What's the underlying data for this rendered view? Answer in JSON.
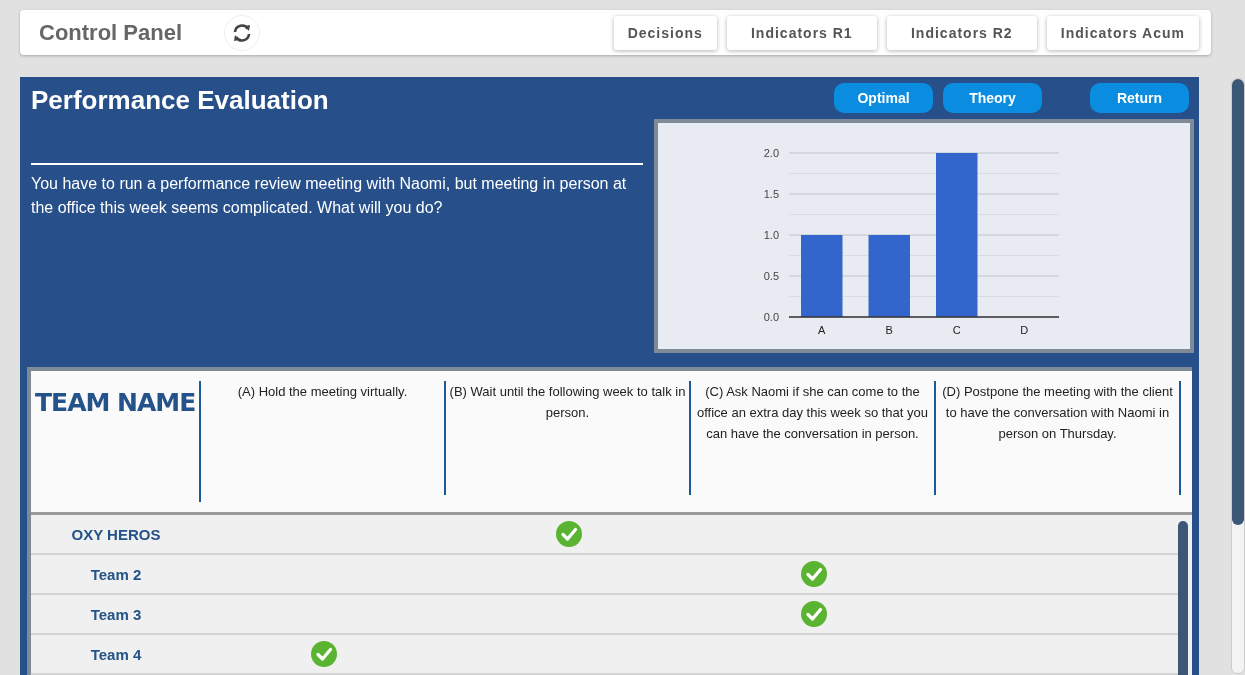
{
  "header": {
    "title": "Control Panel",
    "nav": [
      {
        "label": "Decisions"
      },
      {
        "label": "Indicators R1"
      },
      {
        "label": "Indicators R2"
      },
      {
        "label": "Indicators Acum"
      }
    ]
  },
  "panel": {
    "title": "Performance Evaluation",
    "buttons": [
      "Optimal",
      "Theory",
      "Return"
    ],
    "question": "You have to run a performance review meeting with Naomi, but meeting in person at the office this week seems complicated. What will you do?",
    "chart_data": {
      "type": "bar",
      "categories": [
        "A",
        "B",
        "C",
        "D"
      ],
      "values": [
        1,
        1,
        2,
        0
      ],
      "ylim": [
        0,
        2
      ],
      "grid": true,
      "yticks": [
        {
          "value": 0,
          "label": "0.0"
        },
        {
          "value": 0.5,
          "label": "0.5"
        },
        {
          "value": 1,
          "label": "1.0"
        },
        {
          "value": 1.5,
          "label": "1.5"
        },
        {
          "value": 2,
          "label": "2.0"
        }
      ]
    }
  },
  "table": {
    "team_header": "TEAM NAME",
    "options": [
      "(A) Hold the meeting virtually.",
      "(B) Wait until the following week to talk in person.",
      "(C) Ask Naomi if she can come to the office an extra day this week so that you can have the conversation in person.",
      "(D) Postpone the meeting with the client to have the conversation with Naomi in person on Thursday."
    ],
    "rows": [
      {
        "team": "OXY HEROS",
        "checked": [
          false,
          true,
          false,
          false
        ]
      },
      {
        "team": "Team 2",
        "checked": [
          false,
          false,
          true,
          false
        ]
      },
      {
        "team": "Team 3",
        "checked": [
          false,
          false,
          true,
          false
        ]
      },
      {
        "team": "Team 4",
        "checked": [
          true,
          false,
          false,
          false
        ]
      }
    ]
  }
}
